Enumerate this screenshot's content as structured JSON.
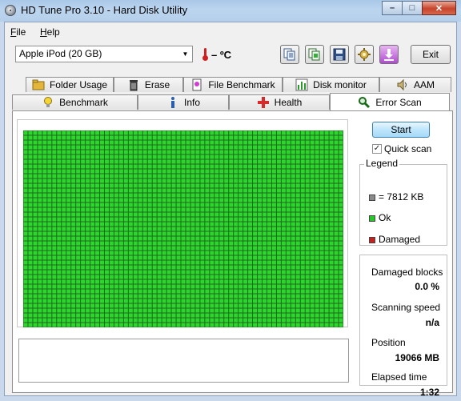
{
  "window": {
    "title": "HD Tune Pro 3.10 - Hard Disk Utility",
    "minimize_glyph": "–",
    "maximize_glyph": "□",
    "close_glyph": "✕"
  },
  "menu": {
    "file": "File",
    "help": "Help"
  },
  "toolbar": {
    "drive": "Apple   iPod (20 GB)",
    "temperature": "– ºC",
    "exit_label": "Exit",
    "icons": [
      "copy-text-icon",
      "copy-screenshot-icon",
      "save-icon",
      "options-icon",
      "download-icon"
    ]
  },
  "tabs": {
    "top_row": [
      {
        "label": "Folder Usage",
        "icon": "folder-icon"
      },
      {
        "label": "Erase",
        "icon": "trash-icon"
      },
      {
        "label": "File Benchmark",
        "icon": "file-benchmark-icon"
      },
      {
        "label": "Disk monitor",
        "icon": "bar-chart-icon"
      },
      {
        "label": "AAM",
        "icon": "speaker-icon"
      }
    ],
    "bottom_row": [
      {
        "label": "Benchmark",
        "icon": "lightbulb-icon"
      },
      {
        "label": "Info",
        "icon": "info-icon"
      },
      {
        "label": "Health",
        "icon": "red-cross-icon"
      },
      {
        "label": "Error Scan",
        "icon": "magnifier-icon",
        "active": true
      }
    ]
  },
  "error_scan": {
    "start_label": "Start",
    "quick_scan_label": "Quick scan",
    "quick_scan_checked": true,
    "block_grid": {
      "columns": 67,
      "rows": 41,
      "ok_fraction": 1.0,
      "ok_color": "#2fd52f",
      "grid_color": "#1b6b1b"
    },
    "legend": {
      "title": "Legend",
      "items": [
        {
          "label": "= 7812 KB",
          "color": "#8a8a8a"
        },
        {
          "label": "Ok",
          "color": "#27c627"
        },
        {
          "label": "Damaged",
          "color": "#c81f1f"
        }
      ]
    },
    "stats": {
      "damaged_blocks_label": "Damaged blocks",
      "damaged_blocks_value": "0.0 %",
      "scanning_speed_label": "Scanning speed",
      "scanning_speed_value": "n/a",
      "position_label": "Position",
      "position_value": "19066 MB",
      "elapsed_time_label": "Elapsed time",
      "elapsed_time_value": "1:32"
    }
  }
}
